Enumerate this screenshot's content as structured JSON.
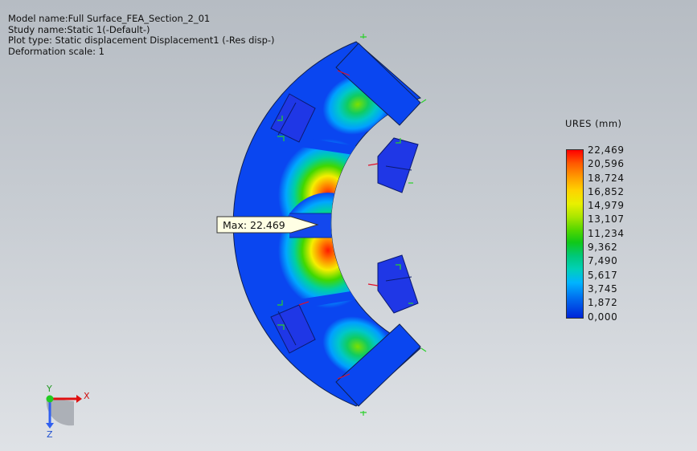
{
  "info": {
    "model_name": "Model name:Full Surface_FEA_Section_2_01",
    "study_name": "Study name:Static 1(-Default-)",
    "plot_type": "Plot type: Static displacement Displacement1 (-Res disp-)",
    "deformation_scale": "Deformation scale: 1"
  },
  "legend": {
    "title": "URES (mm)",
    "labels": [
      "22,469",
      "20,596",
      "18,724",
      "16,852",
      "14,979",
      "13,107",
      "11,234",
      "9,362",
      "7,490",
      "5,617",
      "3,745",
      "1,872",
      "0,000"
    ],
    "max_color": "#ff0000",
    "min_color": "#0024d8"
  },
  "probe": {
    "label": "Max: 22.469"
  },
  "triad": {
    "x_label": "X",
    "y_label": "Y",
    "z_label": "Z"
  },
  "colors": {
    "mesh_base": "#0a46f0",
    "fixture_blue": "#1f37e6"
  }
}
